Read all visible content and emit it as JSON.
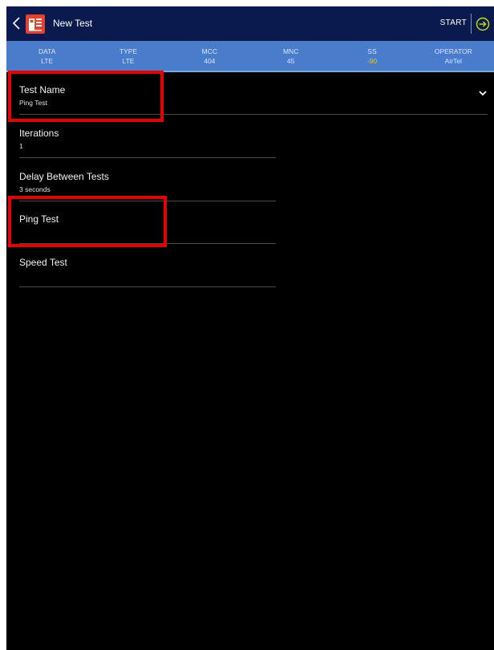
{
  "header": {
    "title": "New Test",
    "start_label": "START",
    "back_icon": "chevron-left-icon",
    "logo_icon": "app-logo-icon",
    "start_icon": "arrow-right-circle-icon"
  },
  "network_info": [
    {
      "label": "DATA",
      "value": "LTE"
    },
    {
      "label": "TYPE",
      "value": "LTE"
    },
    {
      "label": "MCC",
      "value": "404"
    },
    {
      "label": "MNC",
      "value": "45"
    },
    {
      "label": "SS",
      "value": "-90"
    },
    {
      "label": "OPERATOR",
      "value": "AirTel"
    }
  ],
  "form": {
    "test_name": {
      "label": "Test Name",
      "value": "Ping Test"
    },
    "iterations": {
      "label": "Iterations",
      "value": "1"
    },
    "delay": {
      "label": "Delay Between Tests",
      "value": "3 seconds"
    },
    "ping_test": {
      "label": "Ping Test"
    },
    "speed_test": {
      "label": "Speed Test"
    }
  },
  "colors": {
    "navbar": "#0a1a4f",
    "info_strip": "#4a7ccc",
    "warning_value": "#f2c230",
    "highlight_box": "#e60000",
    "background": "#000000"
  }
}
